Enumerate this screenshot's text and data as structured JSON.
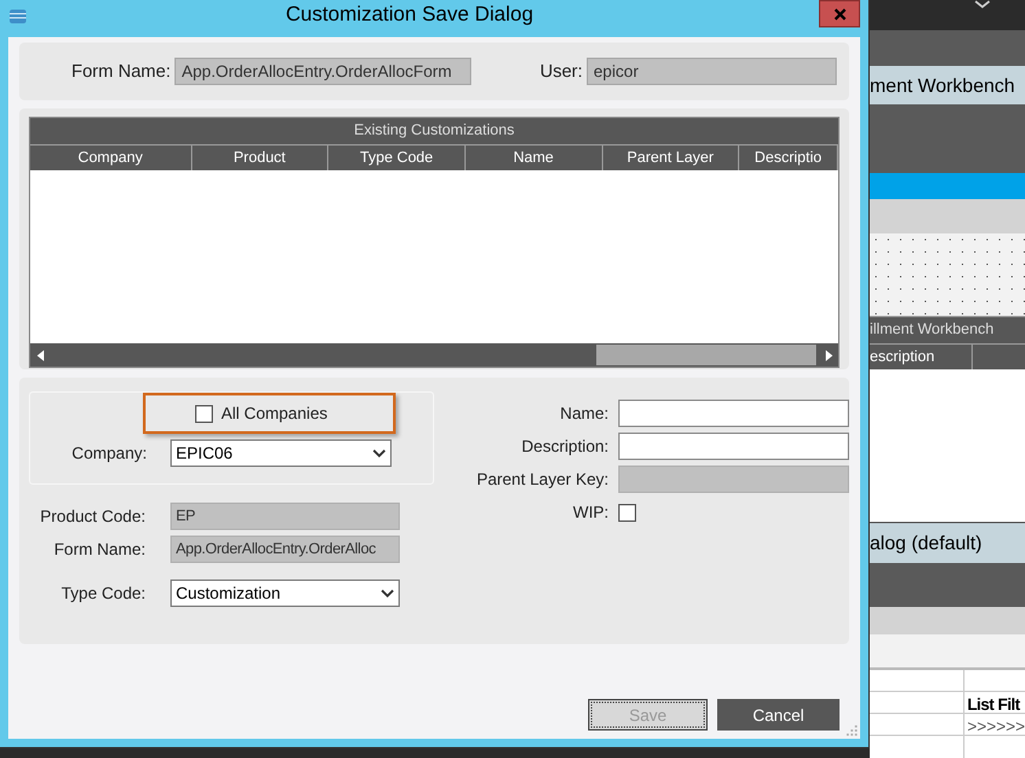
{
  "dialog": {
    "title": "Customization Save Dialog",
    "form_name": {
      "label": "Form Name:",
      "value": "App.OrderAllocEntry.OrderAllocForm"
    },
    "user": {
      "label": "User:",
      "value": "epicor"
    },
    "grid": {
      "title": "Existing Customizations",
      "columns": [
        "Company",
        "Product",
        "Type Code",
        "Name",
        "Parent Layer",
        "Descriptio"
      ]
    },
    "all_companies": {
      "label": "All Companies",
      "checked": false,
      "highlighted": true
    },
    "left_fields": [
      {
        "kind": "select",
        "label": "Company:",
        "value": "EPIC06"
      },
      {
        "kind": "readonly",
        "label": "Product Code:",
        "value": "EP"
      },
      {
        "kind": "readonly",
        "label": "Form Name:",
        "value": "App.OrderAllocEntry.OrderAlloc"
      },
      {
        "kind": "select",
        "label": "Type Code:",
        "value": "Customization"
      }
    ],
    "right_fields": [
      {
        "kind": "text",
        "label": "Name:"
      },
      {
        "kind": "text",
        "label": "Description:"
      },
      {
        "kind": "readonly",
        "label": "Parent Layer Key:"
      },
      {
        "kind": "checkbox",
        "label": "WIP:",
        "checked": false
      }
    ],
    "buttons": [
      {
        "label": "Save",
        "disabled": true
      },
      {
        "label": "Cancel",
        "disabled": false
      }
    ]
  },
  "background": {
    "workbench_tab": "ment Workbench",
    "grid_title": "illment Workbench",
    "column": "escription",
    "dialog_tab": "alog (default)",
    "list_header": "List Filt",
    "list_value": ">>>>>>"
  }
}
